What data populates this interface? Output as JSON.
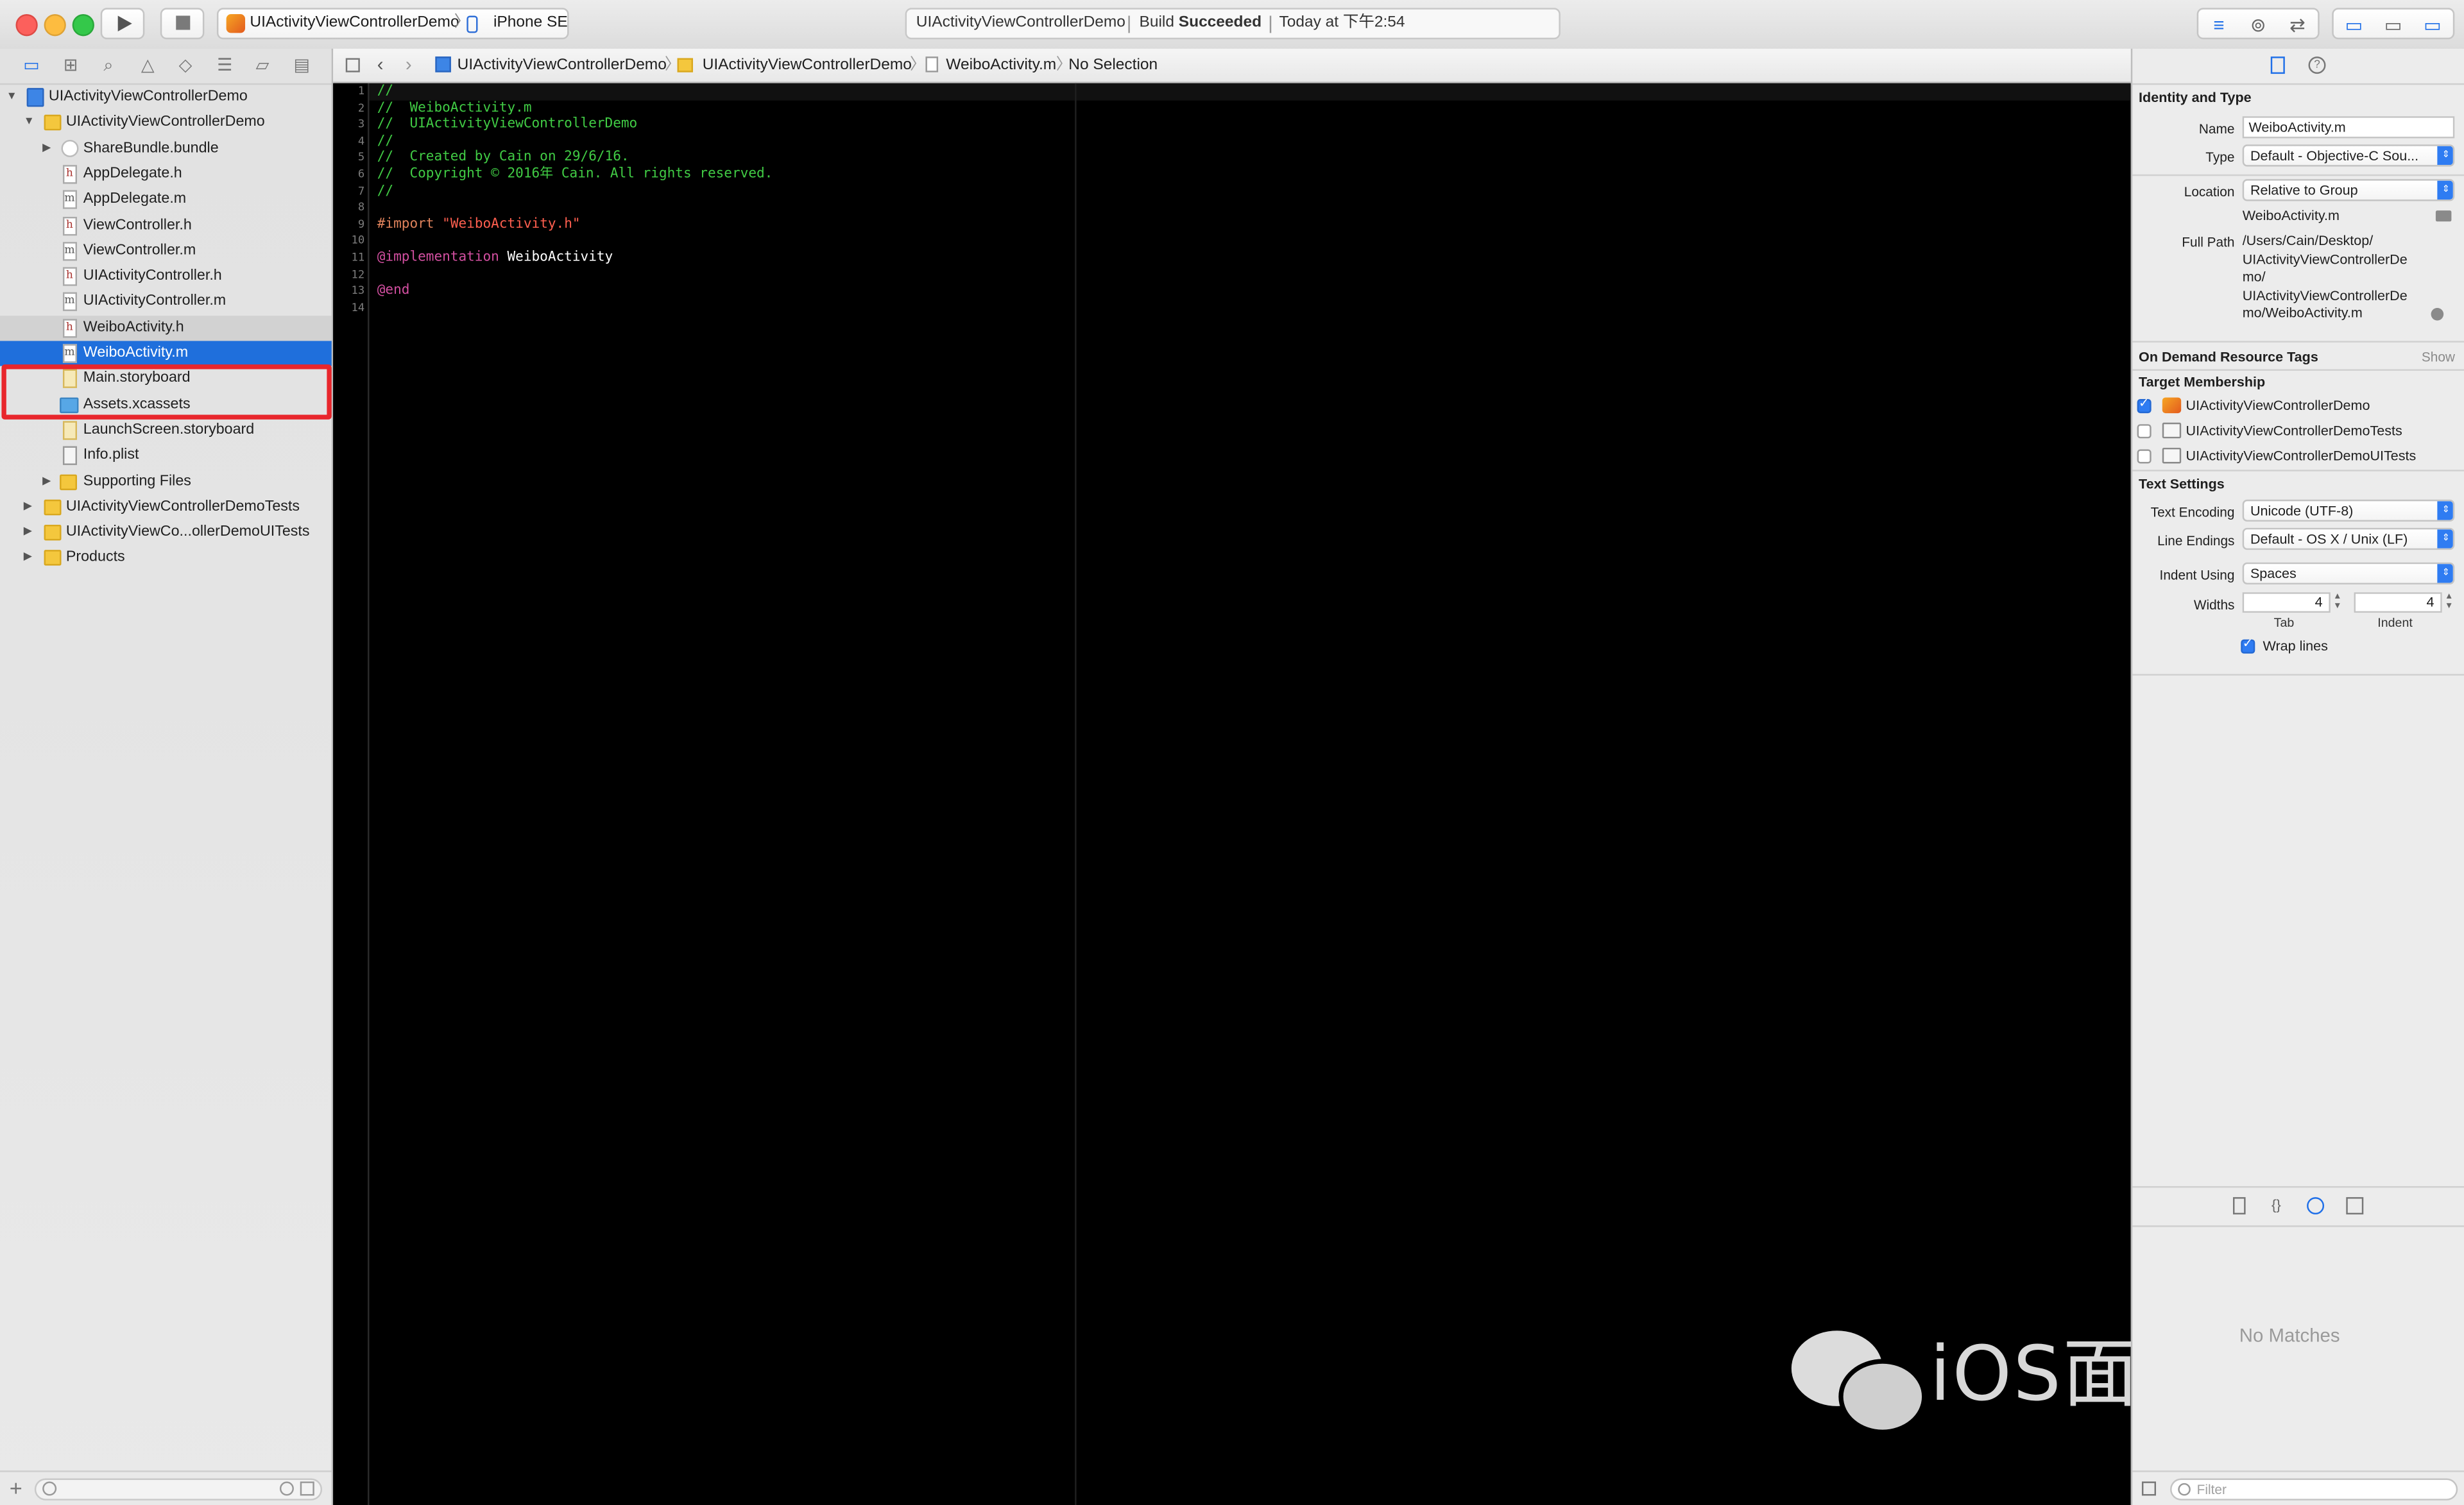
{
  "toolbar": {
    "scheme_name": "UIActivityViewControllerDemo",
    "device_name": "iPhone SE",
    "activity_project": "UIActivityViewControllerDemo",
    "activity_build_prefix": "Build ",
    "activity_build_status": "Succeeded",
    "activity_time": "Today at 下午2:54",
    "chevron": "〉"
  },
  "navigator": {
    "filter_placeholder": "",
    "rows": [
      {
        "label": "UIActivityViewControllerDemo",
        "icon": "project-icon"
      },
      {
        "label": "UIActivityViewControllerDemo",
        "icon": "folder-icon"
      },
      {
        "label": "ShareBundle.bundle",
        "icon": "bundle-icon"
      },
      {
        "label": "AppDelegate.h",
        "icon": "header-file-icon"
      },
      {
        "label": "AppDelegate.m",
        "icon": "implementation-file-icon"
      },
      {
        "label": "ViewController.h",
        "icon": "header-file-icon"
      },
      {
        "label": "ViewController.m",
        "icon": "implementation-file-icon"
      },
      {
        "label": "UIActivityController.h",
        "icon": "header-file-icon"
      },
      {
        "label": "UIActivityController.m",
        "icon": "implementation-file-icon"
      },
      {
        "label": "WeiboActivity.h",
        "icon": "header-file-icon"
      },
      {
        "label": "WeiboActivity.m",
        "icon": "implementation-file-icon"
      },
      {
        "label": "Main.storyboard",
        "icon": "storyboard-icon"
      },
      {
        "label": "Assets.xcassets",
        "icon": "assets-icon"
      },
      {
        "label": "LaunchScreen.storyboard",
        "icon": "storyboard-icon"
      },
      {
        "label": "Info.plist",
        "icon": "plist-icon"
      },
      {
        "label": "Supporting Files",
        "icon": "folder-icon"
      },
      {
        "label": "UIActivityViewControllerDemoTests",
        "icon": "folder-icon"
      },
      {
        "label": "UIActivityViewCo...ollerDemoUITests",
        "icon": "folder-icon"
      },
      {
        "label": "Products",
        "icon": "folder-icon"
      }
    ]
  },
  "jumpbar": {
    "crumb_project": "UIActivityViewControllerDemo",
    "crumb_group": "UIActivityViewControllerDemo",
    "crumb_file": "WeiboActivity.m",
    "crumb_symbol": "No Selection"
  },
  "editor": {
    "line_numbers": [
      "1",
      "2",
      "3",
      "4",
      "5",
      "6",
      "7",
      "8",
      "9",
      "10",
      "11",
      "12",
      "13",
      "14"
    ],
    "line1": "//",
    "line2": "//  WeiboActivity.m",
    "line3": "//  UIActivityViewControllerDemo",
    "line4": "//",
    "line5": "//  Created by Cain on 29/6/16.",
    "line6": "//  Copyright © 2016年 Cain. All rights reserved.",
    "line7": "//",
    "line9_directive": "#import ",
    "line9_string": "\"WeiboActivity.h\"",
    "line11_keyword": "@implementation",
    "line11_name": " WeiboActivity",
    "line13_keyword": "@end"
  },
  "watermark": {
    "text": "iOS面向编码"
  },
  "inspector": {
    "identity_header": "Identity and Type",
    "name_label": "Name",
    "name_value": "WeiboActivity.m",
    "type_label": "Type",
    "type_value": "Default - Objective-C Sou...",
    "location_label": "Location",
    "location_value": "Relative to Group",
    "location_file": "WeiboActivity.m",
    "fullpath_label": "Full Path",
    "fullpath_lines": [
      "/Users/Cain/Desktop/",
      "UIActivityViewControllerDe",
      "mo/",
      "UIActivityViewControllerDe",
      "mo/WeiboActivity.m"
    ],
    "odr_header": "On Demand Resource Tags",
    "odr_show": "Show",
    "target_header": "Target Membership",
    "targets": [
      {
        "label": "UIActivityViewControllerDemo",
        "checked": true
      },
      {
        "label": "UIActivityViewControllerDemoTests",
        "checked": false
      },
      {
        "label": "UIActivityViewControllerDemoUITests",
        "checked": false
      }
    ],
    "text_header": "Text Settings",
    "encoding_label": "Text Encoding",
    "encoding_value": "Unicode (UTF-8)",
    "line_endings_label": "Line Endings",
    "line_endings_value": "Default - OS X / Unix (LF)",
    "indent_using_label": "Indent Using",
    "indent_using_value": "Spaces",
    "widths_label": "Widths",
    "tab_value": "4",
    "indent_value": "4",
    "tab_caption": "Tab",
    "indent_caption": "Indent",
    "wrap_lines_label": "Wrap lines",
    "no_matches": "No Matches",
    "filter_placeholder": "Filter"
  },
  "colors": {
    "selection": "#1f6fdc",
    "highlight_box": "#e8262c",
    "comment": "#41cc45",
    "keyword": "#d24fa0",
    "string": "#ff5f4f",
    "preprocessor": "#e0835c"
  }
}
